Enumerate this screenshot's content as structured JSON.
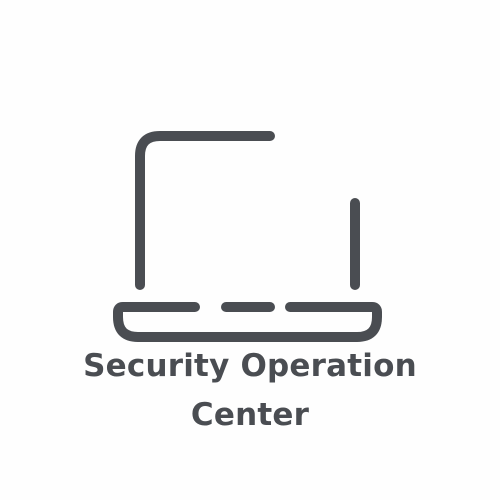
{
  "logo": {
    "icon": "laptop-icon",
    "icon_color": "#4a4d52",
    "background_color": "#fefefe",
    "caption_line_1": "Security Operation",
    "caption_line_2": "Center"
  }
}
